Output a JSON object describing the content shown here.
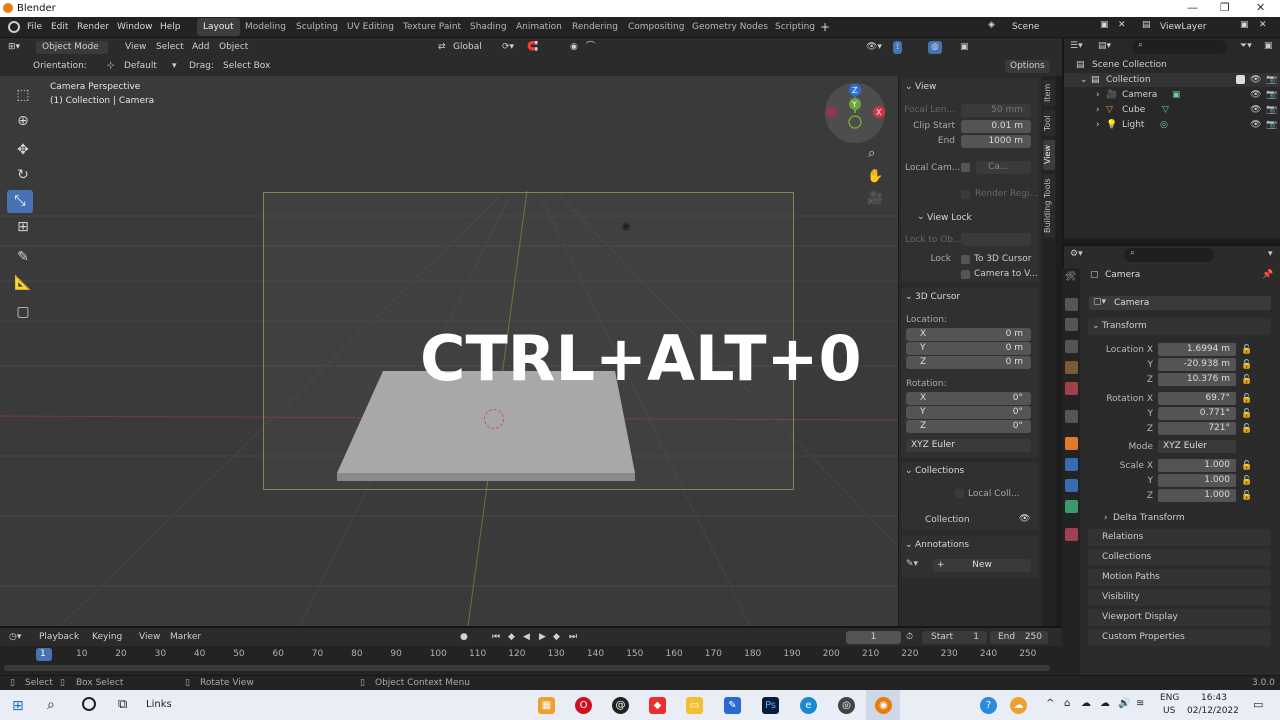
{
  "window": {
    "title": "Blender"
  },
  "menu": [
    "File",
    "Edit",
    "Render",
    "Window",
    "Help"
  ],
  "workspaces": [
    "Layout",
    "Modeling",
    "Sculpting",
    "UV Editing",
    "Texture Paint",
    "Shading",
    "Animation",
    "Rendering",
    "Compositing",
    "Geometry Nodes",
    "Scripting"
  ],
  "active_workspace": "Layout",
  "scene": {
    "label": "Scene",
    "viewlayer": "ViewLayer"
  },
  "header3d": {
    "mode": "Object Mode",
    "menus": [
      "View",
      "Select",
      "Add",
      "Object"
    ],
    "transform": "Global",
    "options": "Options"
  },
  "header3d_row2": {
    "orientation_label": "Orientation:",
    "orientation": "Default",
    "drag_label": "Drag:",
    "drag": "Select Box"
  },
  "viewport": {
    "info_line1": "Camera Perspective",
    "info_line2": "(1) Collection | Camera",
    "overlay_text": "CTRL+ALT+0",
    "gizmo": {
      "z": "Z",
      "y": "Y",
      "x": "X"
    }
  },
  "npanel": {
    "view": {
      "title": "View",
      "focal_label": "Focal Len...",
      "focal": "50 mm",
      "clip_start_label": "Clip Start",
      "clip_start": "0.01 m",
      "end_label": "End",
      "end": "1000 m",
      "local_cam_label": "Local Cam...",
      "local_cam": "Ca...",
      "render_region": "Render Regi..."
    },
    "view_lock": {
      "title": "View Lock",
      "lock_to_obj_label": "Lock to Ob...",
      "lock_label": "Lock",
      "to_cursor": "To 3D Cursor",
      "camera_to_view": "Camera to V..."
    },
    "cursor": {
      "title": "3D Cursor",
      "location_label": "Location:",
      "x_label": "X",
      "x": "0 m",
      "y_label": "Y",
      "y": "0 m",
      "z_label": "Z",
      "z": "0 m",
      "rotation_label": "Rotation:",
      "rx": "0°",
      "ry": "0°",
      "rz": "0°",
      "mode": "XYZ Euler"
    },
    "collections": {
      "title": "Collections",
      "local": "Local Coll...",
      "collection": "Collection"
    },
    "annotations": {
      "title": "Annotations",
      "new": "New"
    }
  },
  "sidetabs": [
    "Item",
    "Tool",
    "View",
    "Building Tools"
  ],
  "outliner": {
    "root": "Scene Collection",
    "collection": "Collection",
    "items": [
      "Camera",
      "Cube",
      "Light"
    ]
  },
  "properties": {
    "object": "Camera",
    "data_name": "Camera",
    "transform": {
      "title": "Transform",
      "loc_x_label": "Location X",
      "loc_x": "1.6994 m",
      "loc_y": "-20.938 m",
      "loc_z": "10.376 m",
      "rot_x_label": "Rotation X",
      "rot_x": "69.7°",
      "rot_y": "0.771°",
      "rot_z": "721°",
      "mode_label": "Mode",
      "mode": "XYZ Euler",
      "scale_x_label": "Scale X",
      "scale_x": "1.000",
      "scale_y": "1.000",
      "scale_z": "1.000",
      "y": "Y",
      "z": "Z"
    },
    "sections": [
      "Delta Transform",
      "Relations",
      "Collections",
      "Motion Paths",
      "Visibility",
      "Viewport Display",
      "Custom Properties"
    ]
  },
  "timeline": {
    "menus": [
      "Playback",
      "Keying",
      "View",
      "Marker"
    ],
    "current_frame": "1",
    "start_label": "Start",
    "start": "1",
    "end_label": "End",
    "end": "250",
    "ticks": [
      "1",
      "10",
      "20",
      "30",
      "40",
      "50",
      "60",
      "70",
      "80",
      "90",
      "100",
      "110",
      "120",
      "130",
      "140",
      "150",
      "160",
      "170",
      "180",
      "190",
      "200",
      "210",
      "220",
      "230",
      "240",
      "250"
    ]
  },
  "statusbar": {
    "select": "Select",
    "box_select": "Box Select",
    "rotate_view": "Rotate View",
    "context_menu": "Object Context Menu",
    "version": "3.0.0"
  },
  "taskbar": {
    "links": "Links",
    "lang": "ENG",
    "region": "US",
    "time": "16:43",
    "date": "02/12/2022"
  },
  "colors": {
    "accent": "#4772b3",
    "camera_frame": "#7a8a55",
    "gizmo_z": "#2f6fd6",
    "gizmo_y": "#6ea53a",
    "gizmo_x": "#d1334b"
  }
}
